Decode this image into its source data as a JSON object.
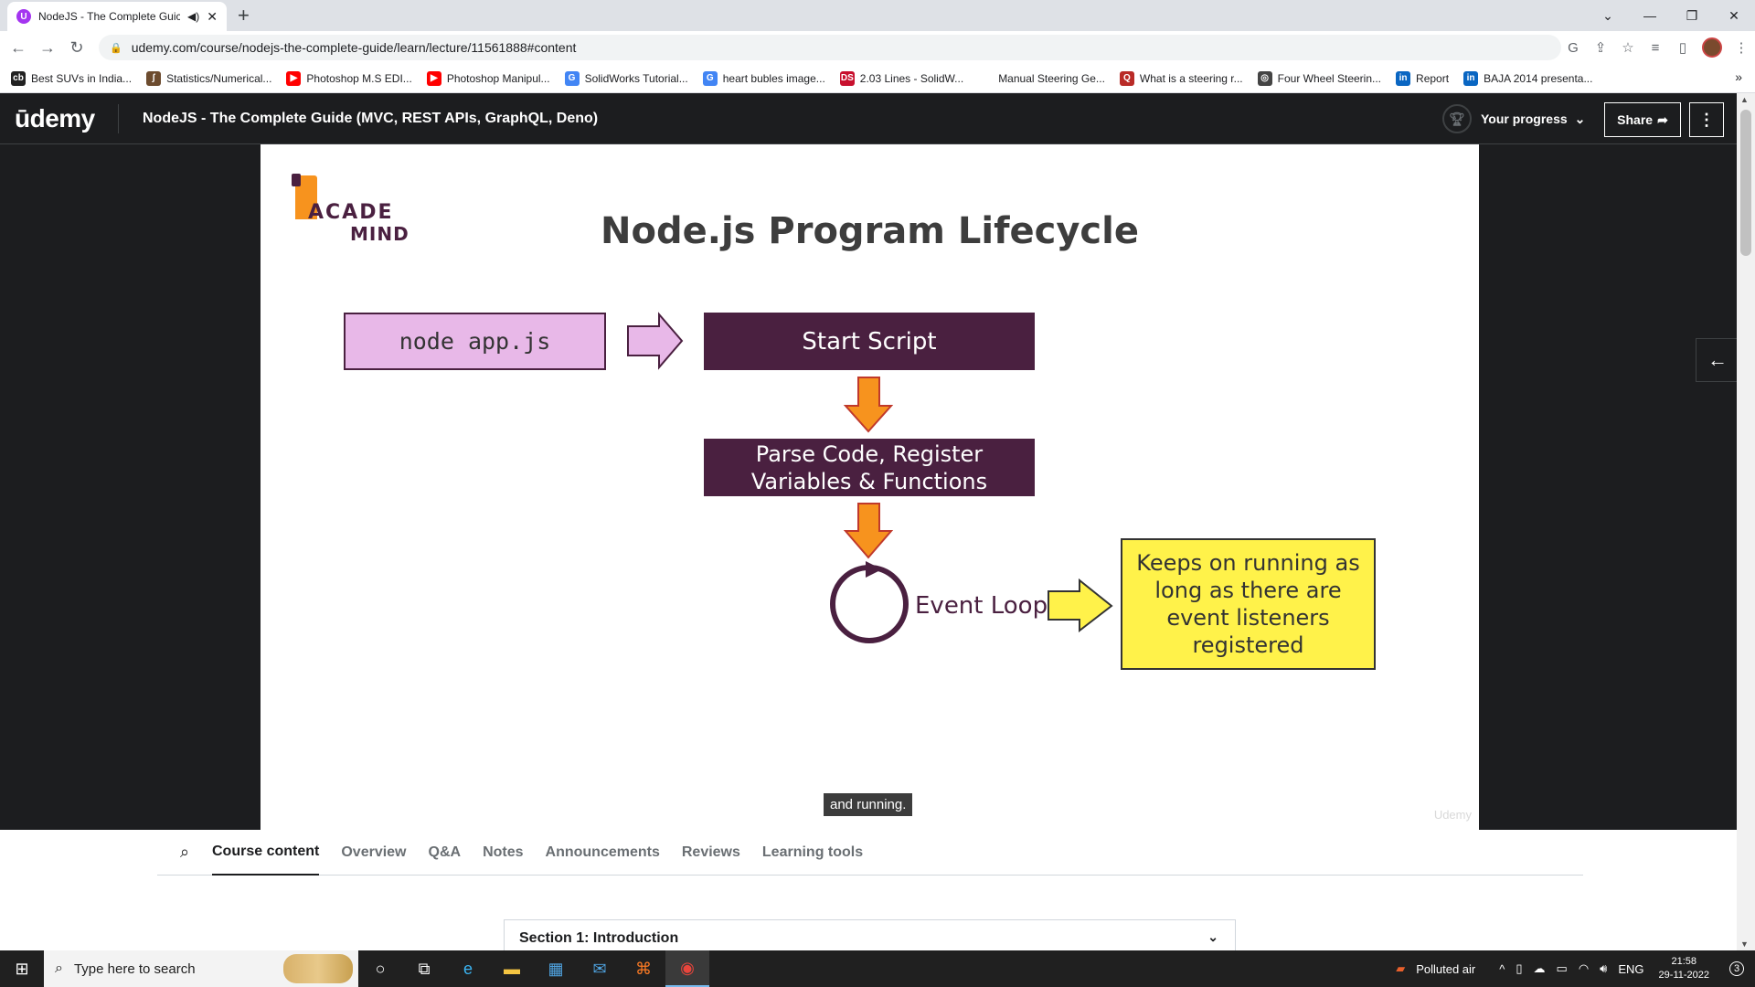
{
  "browser": {
    "tab_title": "NodeJS - The Complete Guic",
    "tab_favicon": "U",
    "new_tab_label": "+",
    "url": "udemy.com/course/nodejs-the-complete-guide/learn/lecture/11561888#content",
    "bookmarks": [
      {
        "label": "Best SUVs in India...",
        "icon_text": "cb",
        "color": "#222222"
      },
      {
        "label": "Statistics/Numerical...",
        "icon_text": "ʃ",
        "color": "#6d4c2f"
      },
      {
        "label": "Photoshop M.S EDI...",
        "icon_text": "▶",
        "color": "#ff0000"
      },
      {
        "label": "Photoshop Manipul...",
        "icon_text": "▶",
        "color": "#ff0000"
      },
      {
        "label": "SolidWorks Tutorial...",
        "icon_text": "G",
        "color": "#4285f4"
      },
      {
        "label": "heart bubles image...",
        "icon_text": "G",
        "color": "#4285f4"
      },
      {
        "label": "2.03 Lines - SolidW...",
        "icon_text": "DS",
        "color": "#c8102e"
      },
      {
        "label": "Manual Steering Ge...",
        "icon_text": "",
        "color": "#ffffff"
      },
      {
        "label": "What is a steering r...",
        "icon_text": "Q",
        "color": "#b92b27"
      },
      {
        "label": "Four Wheel Steerin...",
        "icon_text": "◎",
        "color": "#444444"
      },
      {
        "label": "Report",
        "icon_text": "in",
        "color": "#0a66c2"
      },
      {
        "label": "BAJA 2014 presenta...",
        "icon_text": "in",
        "color": "#0a66c2"
      }
    ],
    "bookmarks_more": "»"
  },
  "header": {
    "logo": "ūdemy",
    "course_title": "NodeJS - The Complete Guide (MVC, REST APIs, GraphQL, Deno)",
    "progress_label": "Your progress",
    "share_label": "Share",
    "menu_label": "⋮"
  },
  "slide": {
    "logo_line1": "ACADE",
    "logo_line2": "MIND",
    "title": "Node.js Program Lifecycle",
    "node_cmd": "node app.js",
    "start_script": "Start Script",
    "parse_line1": "Parse Code, Register",
    "parse_line2": "Variables & Functions",
    "event_loop": "Event Loop",
    "keeps_line1": "Keeps on running as",
    "keeps_line2": "long as there are",
    "keeps_line3": "event listeners",
    "keeps_line4": "registered",
    "arrow_pink_color": "#e8b8e8",
    "arrow_orange_color": "#f7931e",
    "arrow_yellow_color": "#fff24a",
    "circle_color": "#4a2040"
  },
  "video": {
    "caption": "and running.",
    "watermark": "Udemy"
  },
  "lower": {
    "tabs": [
      {
        "label": "Course content",
        "active": true
      },
      {
        "label": "Overview",
        "active": false
      },
      {
        "label": "Q&A",
        "active": false
      },
      {
        "label": "Notes",
        "active": false
      },
      {
        "label": "Announcements",
        "active": false
      },
      {
        "label": "Reviews",
        "active": false
      },
      {
        "label": "Learning tools",
        "active": false
      }
    ],
    "section_title": "Section 1: Introduction"
  },
  "taskbar": {
    "search_placeholder": "Type here to search",
    "air_quality": "Polluted air",
    "language": "ENG",
    "time": "21:58",
    "date": "29-11-2022",
    "notifications": "3"
  }
}
